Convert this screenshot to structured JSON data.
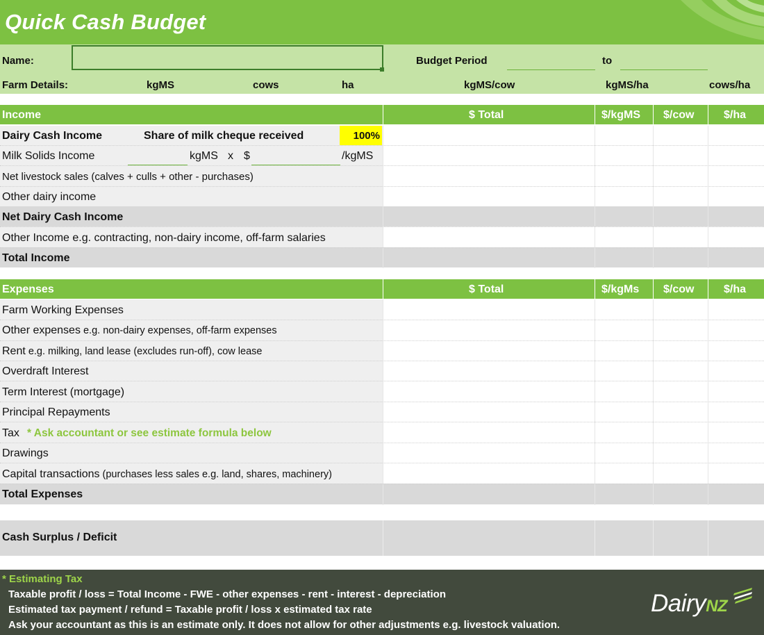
{
  "header": {
    "title": "Quick Cash Budget"
  },
  "info": {
    "name_label": "Name:",
    "budget_period_label": "Budget Period",
    "to_label": "to",
    "farm_details_label": "Farm Details:",
    "units": [
      "kgMS",
      "cows",
      "ha",
      "kgMS/cow",
      "kgMS/ha",
      "cows/ha"
    ]
  },
  "income": {
    "header": "Income",
    "columns": [
      "$ Total",
      "$/kgMS",
      "$/cow",
      "$/ha"
    ],
    "dairy_cash_income": "Dairy Cash Income",
    "share_label": "Share of milk cheque received",
    "share_value": "100%",
    "milk_solids_label": "Milk Solids Income",
    "ms_unit": "kgMS",
    "ms_x": "x",
    "ms_dollar": "$",
    "ms_per": "/kgMS",
    "livestock": "Net livestock sales (calves + culls + other - purchases)",
    "other_dairy": "Other dairy income",
    "net_dairy": "Net Dairy Cash Income",
    "other_income": "Other Income e.g. contracting, non-dairy income, off-farm salaries",
    "total": "Total Income"
  },
  "expenses": {
    "header": "Expenses",
    "columns": [
      "$ Total",
      "$/kgMs",
      "$/cow",
      "$/ha"
    ],
    "fwe": "Farm Working Expenses",
    "other_main": "Other expenses",
    "other_sub": " e.g. non-dairy expenses, off-farm expenses",
    "rent_main": "Rent",
    "rent_sub": " e.g. milking, land lease (excludes run-off), cow lease",
    "overdraft": "Overdraft Interest",
    "term": "Term Interest (mortgage)",
    "principal": "Principal Repayments",
    "tax": "Tax",
    "tax_note": "* Ask accountant or see estimate formula below",
    "drawings": "Drawings",
    "capital_main": "Capital transactions",
    "capital_sub": " (purchases less sales e.g. land, shares, machinery)",
    "total": "Total Expenses"
  },
  "surplus": {
    "label": "Cash Surplus / Deficit"
  },
  "footer": {
    "title": "* Estimating Tax",
    "lines": [
      "Taxable profit / loss = Total Income - FWE - other expenses - rent - interest - depreciation",
      "Estimated tax payment / refund = Taxable profit / loss x estimated tax rate",
      "Ask your accountant as this is an estimate only. It does not allow for other adjustments e.g. livestock valuation."
    ],
    "logo_main": "Dairy",
    "logo_suffix": "NZ"
  },
  "colors": {
    "brand_green": "#7dc142",
    "light_green": "#c5e3a6",
    "highlight_yellow": "#ffff00",
    "footer_bg": "#424a3d",
    "note_green": "#8dc63f"
  }
}
